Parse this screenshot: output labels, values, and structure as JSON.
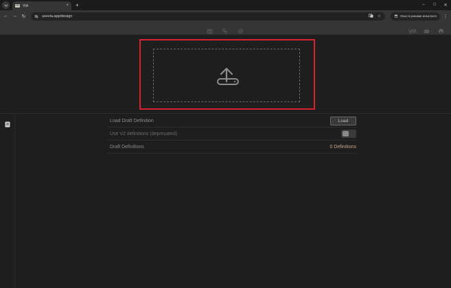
{
  "browser": {
    "tab_title": "VIA",
    "tab_close": "×",
    "new_tab": "+",
    "window_controls": [
      "–",
      "□",
      "✕"
    ],
    "nav": {
      "back": "←",
      "forward": "→",
      "reload": "↻"
    },
    "url": "usevia.app/design",
    "incognito_label": "Окно в режиме инкогнито",
    "menu": "⋮",
    "icons": [
      "translate-icon",
      "star-icon",
      "incognito-icon"
    ]
  },
  "header_icons": [
    "camera-icon",
    "design-icon",
    "settings-icon",
    "via-logo-icon",
    "discord-icon",
    "github-icon"
  ],
  "upload": {
    "icon": "upload-icon",
    "highlight_color": "#d7232d"
  },
  "sidebar": {
    "icon": "document-icon"
  },
  "settings": {
    "load_draft_label": "Load Draft Definition",
    "load_button": "Load",
    "v2_label": "Use V2 definitions (deprecated)",
    "v2_enabled": false,
    "draft_label": "Draft Definitions",
    "draft_count": "0 Definitions"
  },
  "colors": {
    "background": "#1f1e1e",
    "header": "#363535",
    "accent_count": "#c9a98a"
  }
}
